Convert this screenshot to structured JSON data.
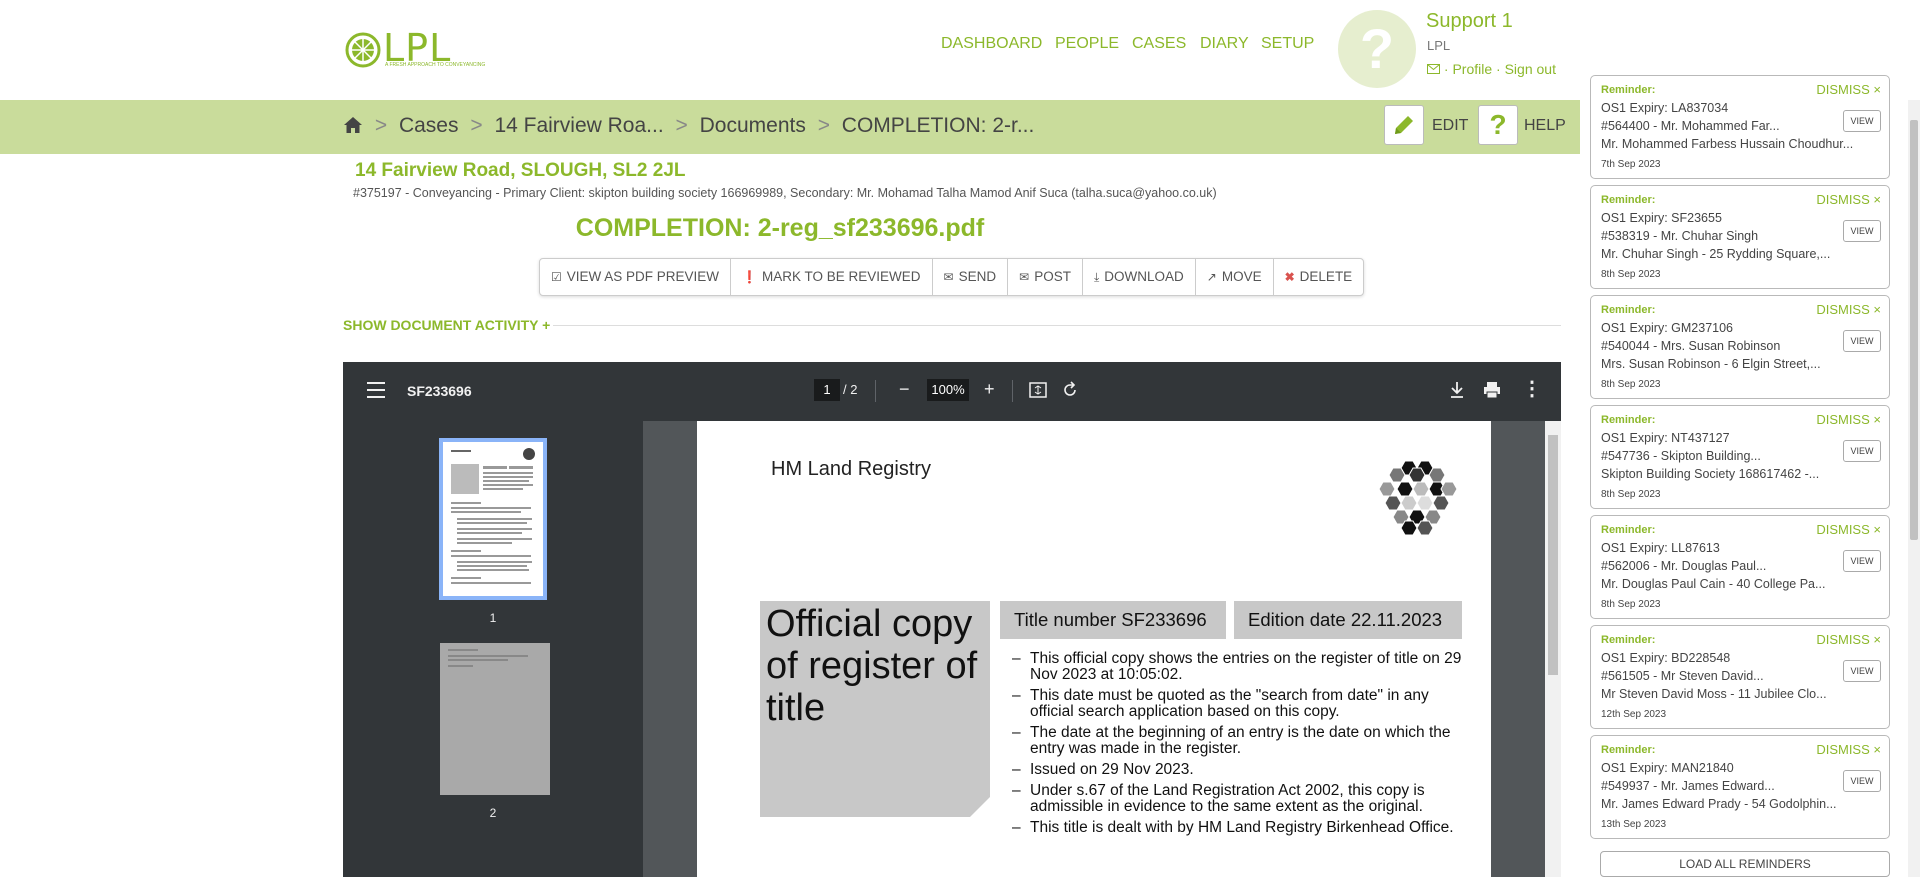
{
  "header": {
    "logo_text": "LPL",
    "logo_tagline": "A FRESH APPROACH TO CONVEYANCING",
    "nav": [
      "DASHBOARD",
      "PEOPLE",
      "CASES",
      "DIARY",
      "SETUP"
    ],
    "user_name": "Support 1",
    "user_org": "LPL",
    "profile_link": "Profile",
    "signout_link": "Sign out",
    "link_separator": "·"
  },
  "breadcrumb": {
    "items": [
      "Cases",
      "14 Fairview Roa...",
      "Documents",
      "COMPLETION: 2-r..."
    ],
    "separator": ">",
    "edit_label": "EDIT",
    "help_label": "HELP"
  },
  "case": {
    "title": "14 Fairview Road, SLOUGH, SL2 2JL",
    "subtitle": "#375197 - Conveyancing - Primary Client: skipton building society 166969989, Secondary: Mr. Mohamad Talha Mamod Anif Suca (talha.suca@yahoo.co.uk)"
  },
  "document": {
    "title": "COMPLETION: 2-reg_sf233696.pdf",
    "actions": [
      "VIEW AS PDF PREVIEW",
      "MARK TO BE REVIEWED",
      "SEND",
      "POST",
      "DOWNLOAD",
      "MOVE",
      "DELETE"
    ],
    "activity_label": "SHOW DOCUMENT ACTIVITY +"
  },
  "viewer": {
    "file_name": "SF233696",
    "current_page": "1",
    "page_total": "/ 2",
    "zoom": "100%",
    "thumbnails": [
      "1",
      "2"
    ]
  },
  "pdf_page": {
    "org": "HM Land Registry",
    "heading": "Official copy of register of title",
    "title_number": "Title number SF233696",
    "edition_date": "Edition date 22.11.2023",
    "bullets": [
      "This official copy shows the entries on the register of title on 29 Nov 2023 at 10:05:02.",
      "This date must be quoted as the \"search from date\" in any official search application based on this copy.",
      "The date at the beginning of an entry is the date on which the entry was made in the register.",
      "Issued on 29 Nov 2023.",
      "Under s.67 of the Land Registration Act 2002, this copy is admissible in evidence to the same extent as the original.",
      "This title is dealt with by HM Land Registry Birkenhead Office."
    ]
  },
  "reminders": {
    "dismiss_label": "DISMISS",
    "view_label": "VIEW",
    "load_all_label": "LOAD ALL REMINDERS",
    "items": [
      {
        "title": "Reminder:",
        "line1": "OS1 Expiry: LA837034",
        "line2": "#564400 - Mr. Mohammed Far...",
        "line3": "Mr. Mohammed Farbess Hussain Choudhur...",
        "date": "7th Sep 2023"
      },
      {
        "title": "Reminder:",
        "line1": "OS1 Expiry: SF23655",
        "line2": "#538319 - Mr. Chuhar Singh",
        "line3": "Mr. Chuhar Singh - 25 Rydding Square,...",
        "date": "8th Sep 2023"
      },
      {
        "title": "Reminder:",
        "line1": "OS1 Expiry: GM237106",
        "line2": "#540044 - Mrs. Susan Robinson",
        "line3": "Mrs. Susan Robinson - 6 Elgin Street,...",
        "date": "8th Sep 2023"
      },
      {
        "title": "Reminder:",
        "line1": "OS1 Expiry: NT437127",
        "line2": "#547736 - Skipton Building...",
        "line3": "Skipton Building Society 168617462 -...",
        "date": "8th Sep 2023"
      },
      {
        "title": "Reminder:",
        "line1": "OS1 Expiry: LL87613",
        "line2": "#562006 - Mr. Douglas Paul...",
        "line3": "Mr. Douglas Paul Cain - 40 College Pa...",
        "date": "8th Sep 2023"
      },
      {
        "title": "Reminder:",
        "line1": "OS1 Expiry: BD228548",
        "line2": "#561505 - Mr Steven David...",
        "line3": "Mr Steven David Moss - 11 Jubilee Clo...",
        "date": "12th Sep 2023"
      },
      {
        "title": "Reminder:",
        "line1": "OS1 Expiry: MAN21840",
        "line2": "#549937 - Mr. James Edward...",
        "line3": "Mr. James Edward Prady - 54 Godolphin...",
        "date": "13th Sep 2023"
      }
    ]
  }
}
